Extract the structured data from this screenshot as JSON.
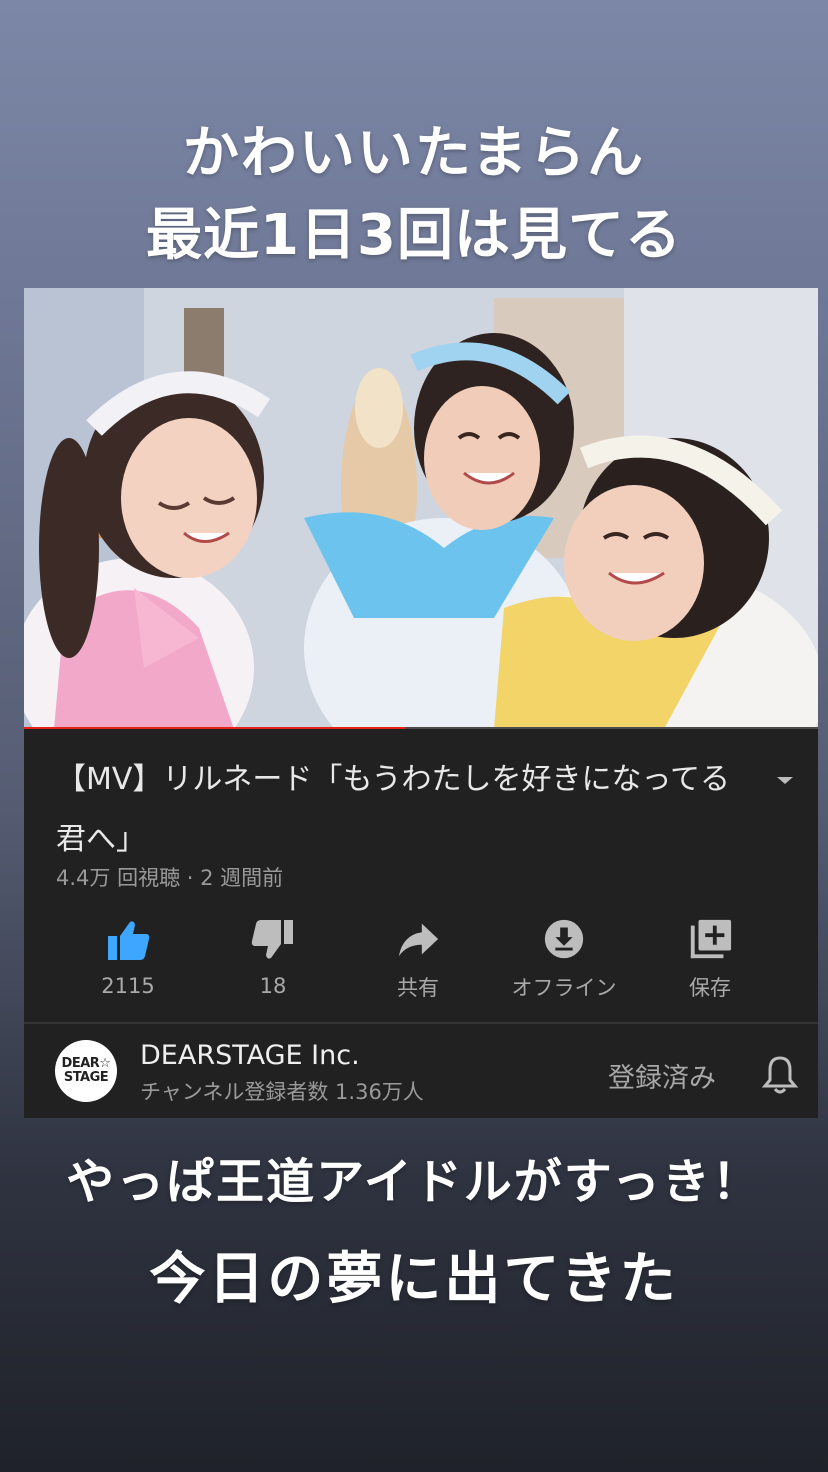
{
  "captions": {
    "line1": "かわいいたまらん",
    "line2": "最近1日3回は見てる",
    "line3": "やっぱ王道アイドルがすっき！",
    "line4": "今日の夢に出てきた"
  },
  "video": {
    "title": "【MV】リルネード「もうわたしを好きになってる君へ」",
    "stats": "4.4万 回視聴 · 2 週間前",
    "progress_fraction": 0.48
  },
  "actions": {
    "like": {
      "label": "2115",
      "icon": "thumbs-up-icon",
      "active": true
    },
    "dislike": {
      "label": "18",
      "icon": "thumbs-down-icon"
    },
    "share": {
      "label": "共有",
      "icon": "share-icon"
    },
    "offline": {
      "label": "オフライン",
      "icon": "download-icon"
    },
    "save": {
      "label": "保存",
      "icon": "add-to-playlist-icon"
    }
  },
  "channel": {
    "avatar_text_1": "DEAR☆",
    "avatar_text_2": "STAGE",
    "name": "DEARSTAGE Inc.",
    "subscribers": "チャンネル登録者数 1.36万人",
    "subscribe_state": "登録済み"
  },
  "colors": {
    "accent_blue": "#3ea6ff",
    "progress_red": "#e62117",
    "card_bg": "#212121"
  }
}
